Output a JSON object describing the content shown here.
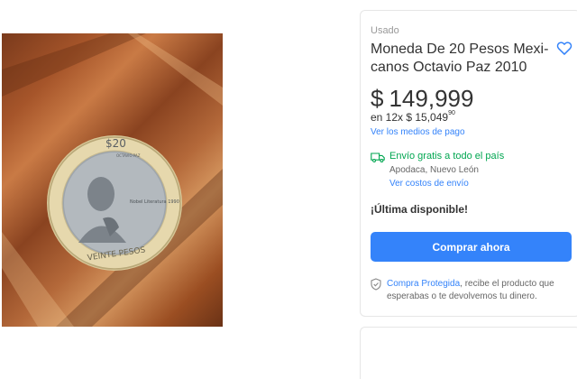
{
  "product": {
    "condition": "Usado",
    "title": "Moneda De 20 Pesos Mexi-canos Octavio Paz 2010",
    "title_line1": "Moneda De 20 Pesos Mexi-",
    "title_line2": "canos Octavio Paz 2010",
    "currency_symbol": "$",
    "price": "149,999",
    "installments_prefix": "en 12x $ 15,049",
    "installments_cents": "90",
    "payment_methods_link": "Ver los medios de pago",
    "stock_message": "¡Última disponible!"
  },
  "shipping": {
    "free_text": "Envío gratis a todo el país",
    "location": "Apodaca, Nuevo León",
    "costs_link": "Ver costos de envío",
    "status_color": "#00a650"
  },
  "actions": {
    "buy_label": "Comprar ahora",
    "buy_color": "#3483fa"
  },
  "protection": {
    "link_text": "Compra Protegida",
    "rest_text": ", recibe el producto que esperabas o te devolvemos tu dinero."
  },
  "coin": {
    "denomination": "$20",
    "top_text": "OCTAVIO PAZ",
    "side_text": "Nobel Literatura 1990",
    "bottom_text": "VEINTE PESOS"
  },
  "icons": {
    "favorite": "heart-outline-icon",
    "shipping": "truck-icon",
    "protection": "shield-check-icon"
  }
}
